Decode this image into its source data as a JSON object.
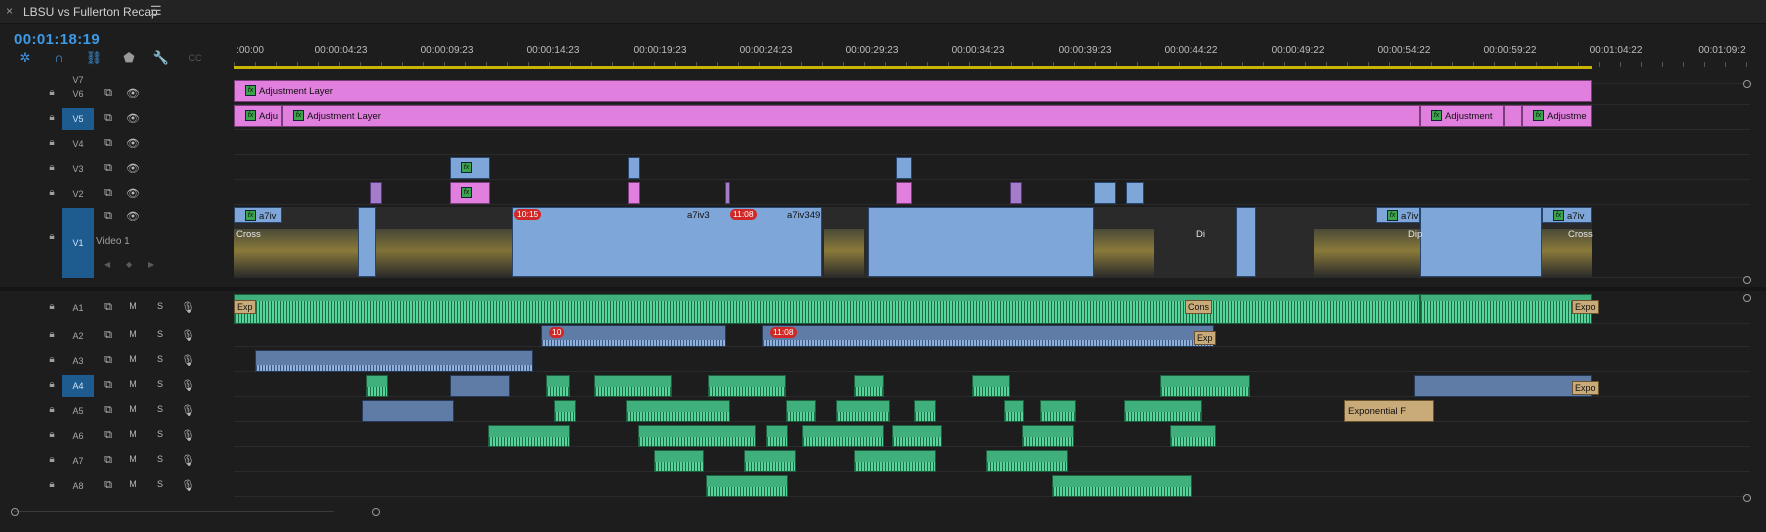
{
  "sequence": {
    "close_icon": "×",
    "title": "LBSU vs Fullerton Recap",
    "menu_icon": "☰",
    "timecode": "00:01:18:19"
  },
  "toolbar": [
    {
      "name": "snap-icon",
      "glyph": "✲"
    },
    {
      "name": "magnet-icon",
      "glyph": "∩"
    },
    {
      "name": "linked-selection-icon",
      "glyph": "⛓"
    },
    {
      "name": "marker-icon",
      "glyph": "⬟"
    },
    {
      "name": "wrench-icon",
      "glyph": "🔧"
    },
    {
      "name": "captions-icon",
      "glyph": "CC"
    }
  ],
  "ruler_ticks": [
    "00:00",
    "00:00:04:23",
    "00:00:09:23",
    "00:00:14:23",
    "00:00:19:23",
    "00:00:24:23",
    "00:00:29:23",
    "00:00:34:23",
    "00:00:39:23",
    "00:00:44:22",
    "00:00:49:22",
    "00:00:54:22",
    "00:00:59:22",
    "00:01:04:22",
    "00:01:09:2"
  ],
  "ruler_first_tick_visible": ":00:00",
  "video_tracks": [
    {
      "name": "V7"
    },
    {
      "name": "V6"
    },
    {
      "name": "V5"
    },
    {
      "name": "V4"
    },
    {
      "name": "V3"
    },
    {
      "name": "V2"
    },
    {
      "name": "V1",
      "label": "Video 1"
    }
  ],
  "audio_tracks": [
    {
      "name": "A1"
    },
    {
      "name": "A2"
    },
    {
      "name": "A3"
    },
    {
      "name": "A4"
    },
    {
      "name": "A5"
    },
    {
      "name": "A6"
    },
    {
      "name": "A7"
    },
    {
      "name": "A8"
    }
  ],
  "track_controls": {
    "mute": "M",
    "solo": "S"
  },
  "clips": {
    "v6_adjustment": "Adjustment Layer",
    "v5_adju": "Adju",
    "v5_adjustment": "Adjustment Layer",
    "v5_adjustment_2": "Adjustment",
    "v5_adjustme": "Adjustme",
    "v1_a7iv": "a7iv",
    "v1_cross": "Cross",
    "v1_a7iv3": "a7iv3",
    "v1_a7iv349": "a7iv349",
    "v1_di": "Di",
    "v1_dip": "Dip",
    "v1_a7iv_end": "a7iv",
    "v1_cross_end": "Cross",
    "tag_1015": "10:15",
    "tag_1108": "11:08",
    "a1_exp": "Exp",
    "a1_cons": "Cons",
    "a1_expo": "Expo",
    "a2_tag": "10",
    "a2_tag2": "11:08",
    "a2_exp": "Exp",
    "a4_expo": "Expo",
    "a5_exponential": "Exponential F",
    "fx": "fx"
  },
  "colors": {
    "accent": "#3d9ae8",
    "adjustment": "#e07fde",
    "video": "#7fa6d8",
    "audio": "#3fb07b",
    "work_area": "#c9b400"
  }
}
